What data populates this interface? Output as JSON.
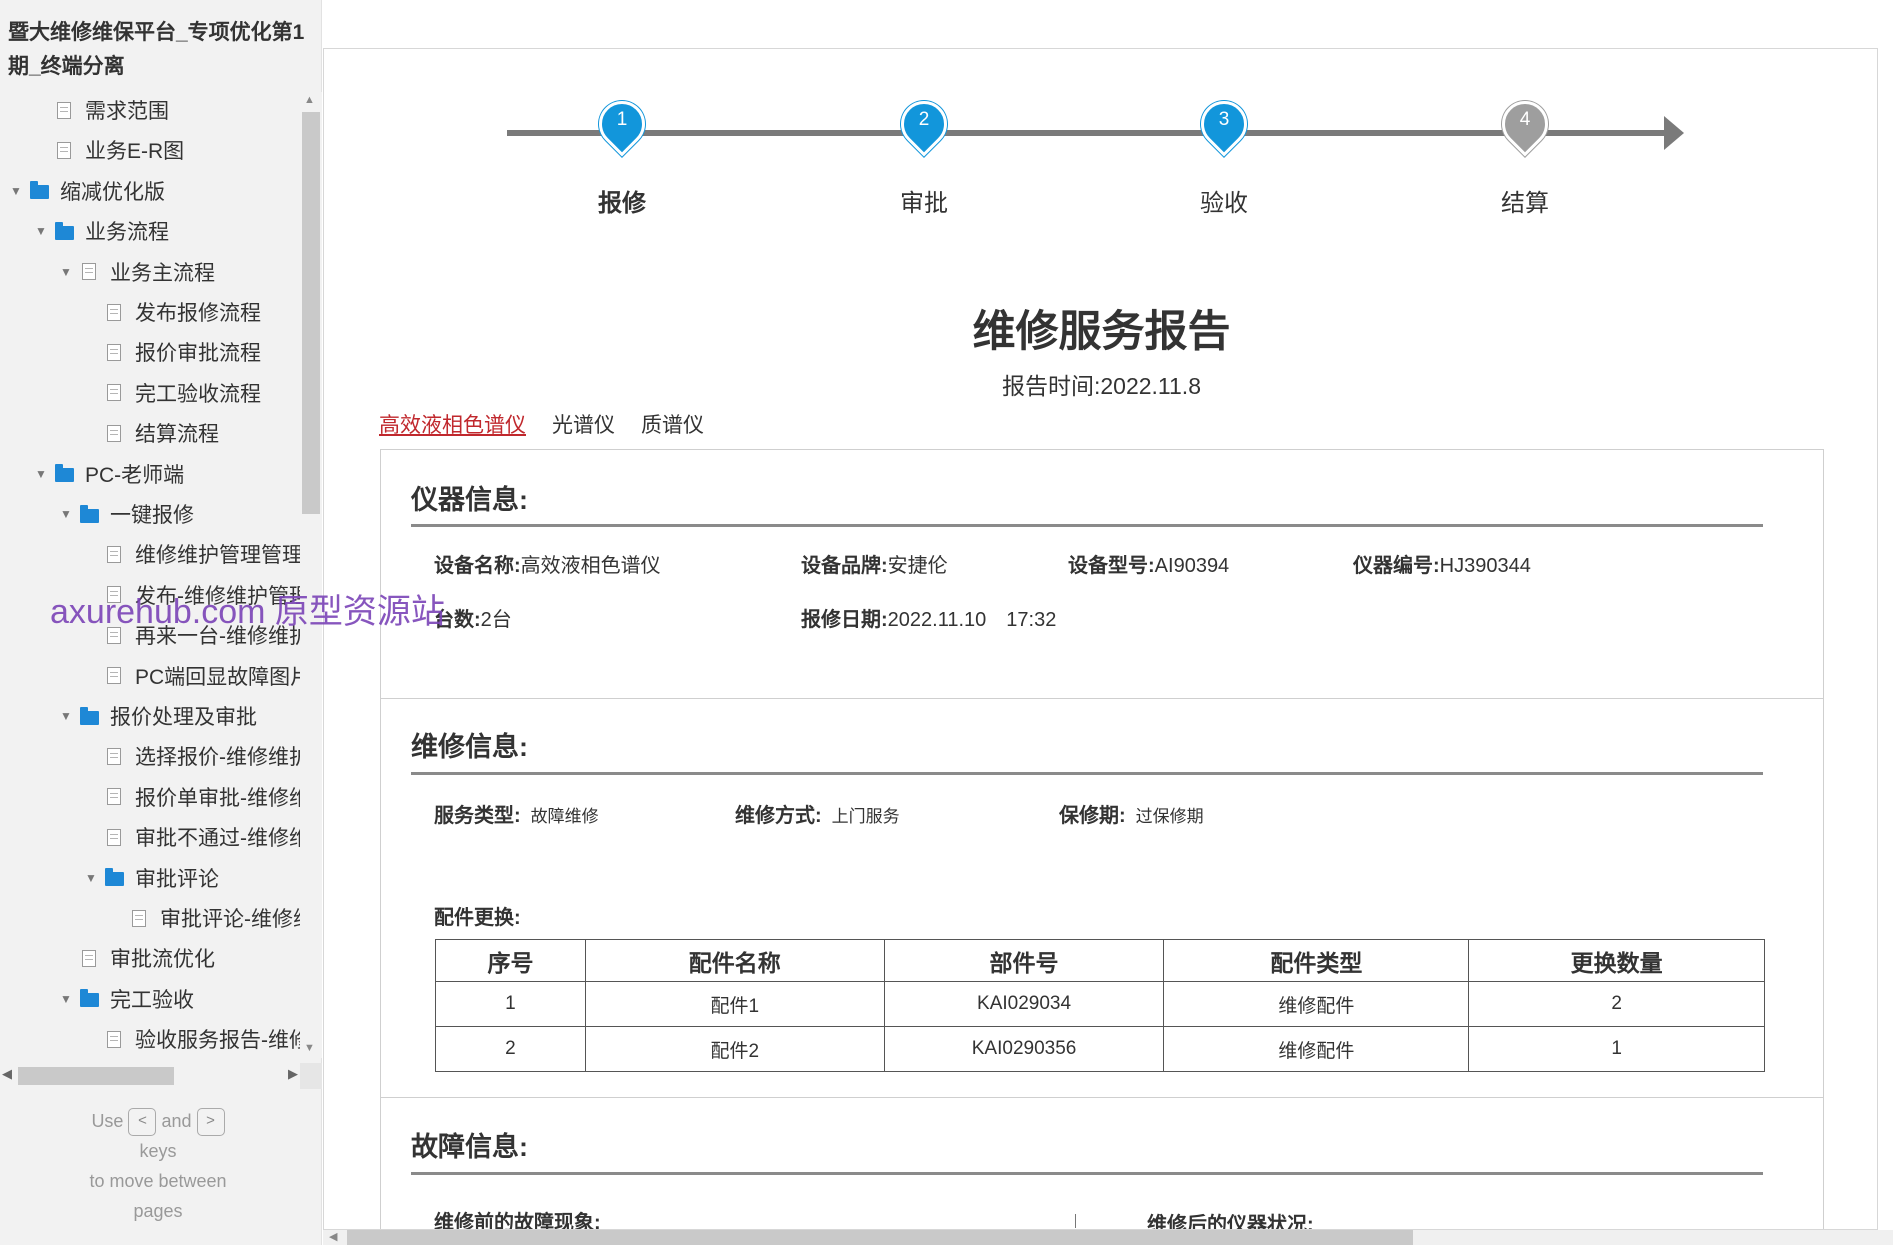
{
  "project": {
    "title": "暨大维修维保平台_专项优化第1期_终端分离"
  },
  "tree": [
    {
      "label": "需求范围",
      "type": "page",
      "level": 1
    },
    {
      "label": "业务E-R图",
      "type": "page",
      "level": 1
    },
    {
      "label": "缩减优化版",
      "type": "folder",
      "level": 0,
      "expanded": true
    },
    {
      "label": "业务流程",
      "type": "folder",
      "level": 1,
      "expanded": true
    },
    {
      "label": "业务主流程",
      "type": "page",
      "level": 2,
      "expanded": true
    },
    {
      "label": "发布报修流程",
      "type": "page",
      "level": 3
    },
    {
      "label": "报价审批流程",
      "type": "page",
      "level": 3
    },
    {
      "label": "完工验收流程",
      "type": "page",
      "level": 3
    },
    {
      "label": "结算流程",
      "type": "page",
      "level": 3
    },
    {
      "label": "PC-老师端",
      "type": "folder",
      "level": 1,
      "expanded": true
    },
    {
      "label": "一键报修",
      "type": "folder",
      "level": 2,
      "expanded": true
    },
    {
      "label": "维修维护管理管理",
      "type": "page",
      "level": 3
    },
    {
      "label": "发布-维修维护管理",
      "type": "page",
      "level": 3
    },
    {
      "label": "再来一台-维修维护",
      "type": "page",
      "level": 3
    },
    {
      "label": "PC端回显故障图片",
      "type": "page",
      "level": 3
    },
    {
      "label": "报价处理及审批",
      "type": "folder",
      "level": 2,
      "expanded": true
    },
    {
      "label": "选择报价-维修维护",
      "type": "page",
      "level": 3
    },
    {
      "label": "报价单审批-维修维",
      "type": "page",
      "level": 3
    },
    {
      "label": "审批不通过-维修维",
      "type": "page",
      "level": 3
    },
    {
      "label": "审批评论",
      "type": "folder",
      "level": 3,
      "expanded": true
    },
    {
      "label": "审批评论-维修维护",
      "type": "page",
      "level": 4
    },
    {
      "label": "审批流优化",
      "type": "page",
      "level": 2
    },
    {
      "label": "完工验收",
      "type": "folder",
      "level": 2,
      "expanded": true
    },
    {
      "label": "验收服务报告-维修",
      "type": "page",
      "level": 3
    }
  ],
  "key_hint": {
    "use": "Use",
    "and": "and",
    "keys": "keys",
    "line2": "to move between",
    "line3": "pages",
    "key_prev": "<",
    "key_next": ">"
  },
  "watermark": "axurehub.com 原型资源站",
  "steps": [
    {
      "num": "1",
      "label": "报修",
      "state": "active"
    },
    {
      "num": "2",
      "label": "审批",
      "state": "active"
    },
    {
      "num": "3",
      "label": "验收",
      "state": "active"
    },
    {
      "num": "4",
      "label": "结算",
      "state": "pending"
    }
  ],
  "report": {
    "title": "维修服务报告",
    "time": "报告时间:2022.11.8"
  },
  "tabs": [
    {
      "label": "高效液相色谱仪",
      "active": true
    },
    {
      "label": "光谱仪",
      "active": false
    },
    {
      "label": "质谱仪",
      "active": false
    }
  ],
  "instrument": {
    "title": "仪器信息:",
    "name_label": "设备名称:",
    "name": "高效液相色谱仪",
    "brand_label": "设备品牌:",
    "brand": "安捷伦",
    "model_label": "设备型号:",
    "model": "AI90394",
    "code_label": "仪器编号:",
    "code": "HJ390344",
    "count_label": "台数:",
    "count": "2台",
    "date_label": "报修日期:",
    "date": "2022.11.10　17:32"
  },
  "repair": {
    "title": "维修信息:",
    "service_label": "服务类型:",
    "service": "故障维修",
    "method_label": "维修方式:",
    "method": "上门服务",
    "warranty_label": "保修期:",
    "warranty": "过保修期",
    "parts_label": "配件更换:",
    "columns": [
      "序号",
      "配件名称",
      "部件号",
      "配件类型",
      "更换数量"
    ],
    "rows": [
      [
        "1",
        "配件1",
        "KAI029034",
        "维修配件",
        "2"
      ],
      [
        "2",
        "配件2",
        "KAI0290356",
        "维修配件",
        "1"
      ]
    ]
  },
  "fault": {
    "title": "故障信息:",
    "before_label": "维修前的故障现象:",
    "after_label": "维修后的仪器状况:"
  },
  "colors": {
    "accent": "#1296db",
    "pending": "#9e9e9e",
    "active_tab": "#c0282d",
    "folder": "#1e88d6"
  }
}
